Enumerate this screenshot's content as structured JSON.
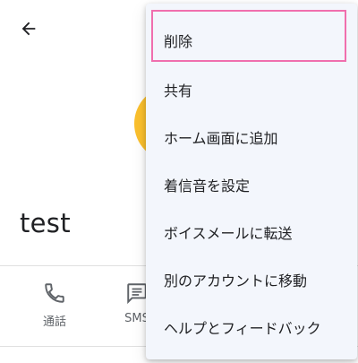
{
  "contact": {
    "name": "test",
    "avatar_color": "#fbc02d"
  },
  "actions": [
    {
      "label": "通話",
      "icon": "phone-icon"
    },
    {
      "label": "SMS",
      "icon": "message-icon"
    }
  ],
  "menu": {
    "items": [
      {
        "label": "削除"
      },
      {
        "label": "共有"
      },
      {
        "label": "ホーム画面に追加"
      },
      {
        "label": "着信音を設定"
      },
      {
        "label": "ボイスメールに転送"
      },
      {
        "label": "別のアカウントに移動"
      },
      {
        "label": "ヘルプとフィードバック"
      }
    ],
    "highlight_color": "#f06fae"
  }
}
